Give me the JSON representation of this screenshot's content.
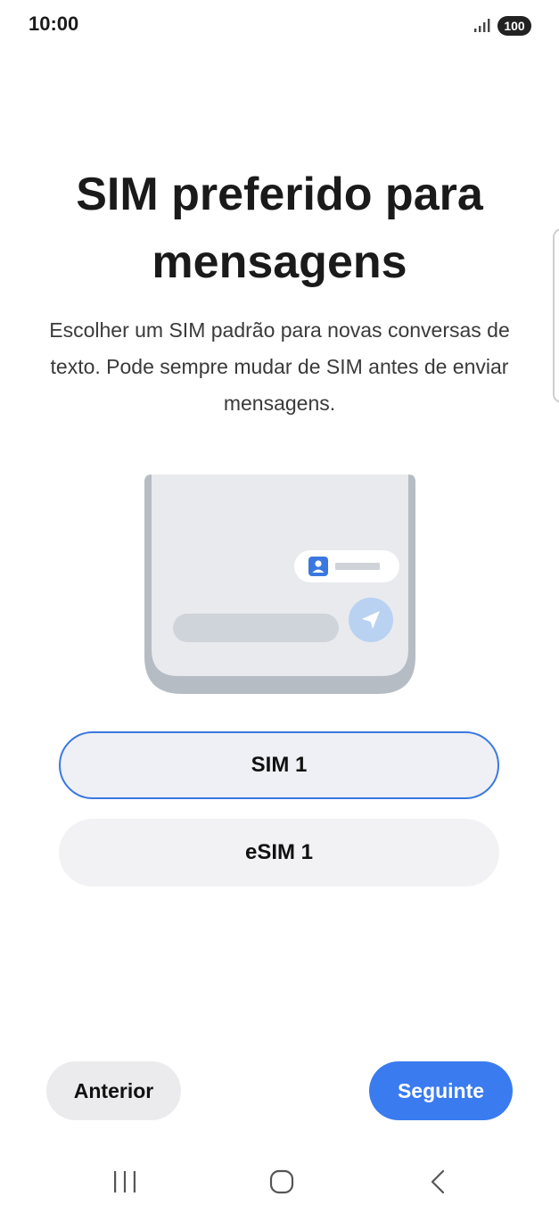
{
  "status_bar": {
    "time": "10:00",
    "signal_icon": "signal-bars-icon",
    "battery": "100"
  },
  "page": {
    "title": "SIM preferido para mensagens",
    "description": "Escolher um SIM padrão para novas conversas de texto. Pode sempre mudar de SIM antes de enviar mensagens."
  },
  "illustration": {
    "icons": [
      "contact-card-icon",
      "send-icon"
    ],
    "colors": {
      "panel": "#e9eaee",
      "frame": "#b6bcc4",
      "accent": "#3a78e0",
      "send_circle": "#b9d2f1"
    }
  },
  "options": [
    {
      "label": "SIM 1",
      "selected": true
    },
    {
      "label": "eSIM 1",
      "selected": false
    }
  ],
  "buttons": {
    "previous": "Anterior",
    "next": "Seguinte"
  },
  "nav_bar": {
    "icons": [
      "recents-icon",
      "home-icon",
      "back-icon"
    ]
  },
  "colors": {
    "accent": "#3a7bf0",
    "selected_border": "#3a78e0"
  }
}
